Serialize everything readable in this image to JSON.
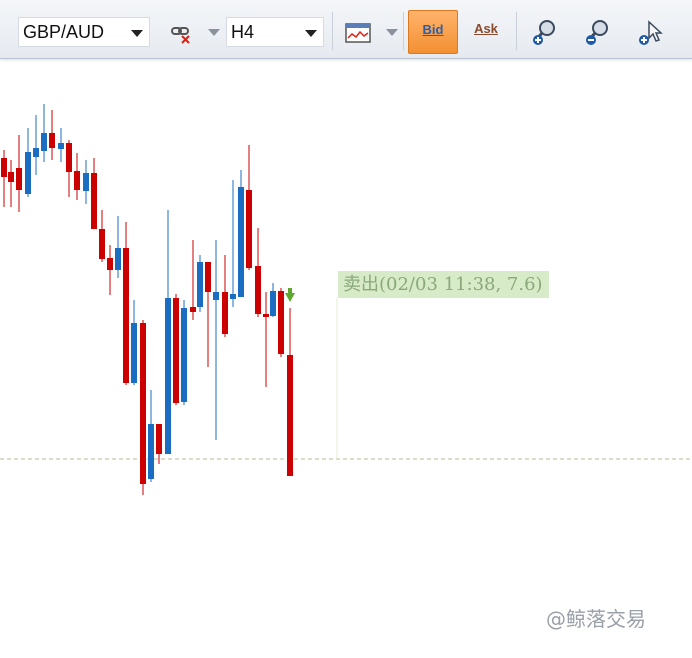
{
  "toolbar": {
    "symbol": "GBP/AUD",
    "timeframe": "H4",
    "bid_label": "Bid",
    "ask_label": "Ask",
    "icons": [
      "chain-delete-icon",
      "line-chart-icon",
      "zoom-in-icon",
      "zoom-out-icon",
      "pointer-plus-icon"
    ]
  },
  "trade_annotation": "卖出(02/03 11:38, 7.6)",
  "watermark": "@鲸落交易",
  "colors": {
    "bear": "#cc0000",
    "bull": "#1b6dc1",
    "annotation_bg": "#d8ebc8",
    "bid_button": "#f5a04c"
  }
}
